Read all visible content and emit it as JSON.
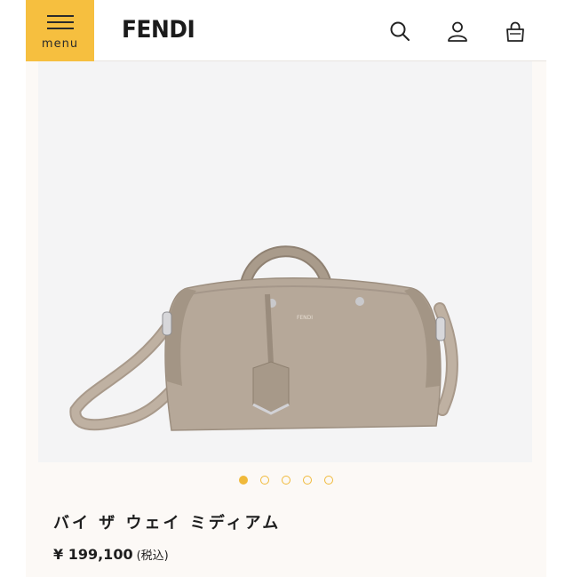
{
  "header": {
    "menu_label": "menu",
    "logo_text": "FENDI",
    "icons": [
      "search-icon",
      "account-icon",
      "shopping-bag-icon"
    ],
    "brand_color": "#f6bf3f"
  },
  "product": {
    "image_label": "FENDI",
    "name": "バイ ザ ウェイ ミディアム",
    "price": "¥ 199,100",
    "tax_note": "(税込)"
  },
  "carousel": {
    "total": 5,
    "active_index": 0,
    "dot_color": "#f0b93a"
  }
}
